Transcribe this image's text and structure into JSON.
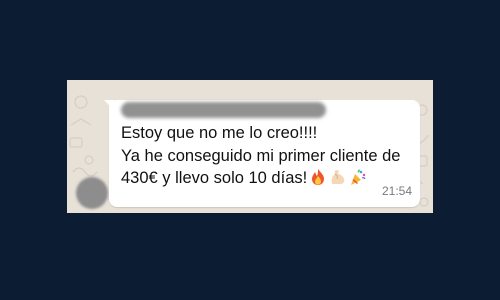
{
  "message": {
    "sender": "",
    "lines": [
      "Estoy que no me lo creo!!!!",
      "Ya he conseguido mi primer cliente de",
      "430€ y llevo solo 10 días!"
    ],
    "emojis": [
      "fire-emoji",
      "flexed-biceps-emoji",
      "party-popper-emoji"
    ],
    "time": "21:54"
  },
  "colors": {
    "background": "#0c1c32",
    "chat_wallpaper": "#e8e1d8",
    "bubble": "#ffffff",
    "text": "#111111",
    "timestamp": "#7a7a7a"
  }
}
